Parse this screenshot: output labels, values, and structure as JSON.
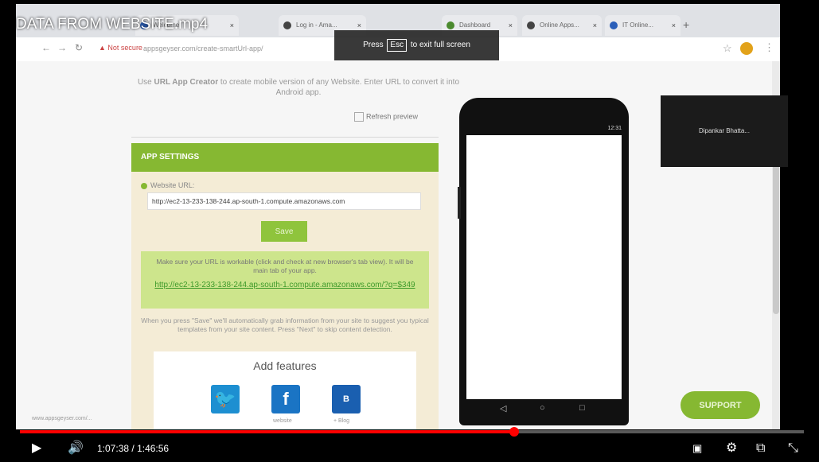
{
  "video": {
    "title": "DATA FROM WEBSITE.mp4",
    "fullscreen_hint_pre": "Press",
    "fullscreen_hint_key": "Esc",
    "fullscreen_hint_post": "to exit full screen",
    "viewer_name": "Dipankar Bhatta...",
    "current_time": "1:07:38",
    "time_separator": " / ",
    "duration": "1:46:56",
    "progress_fraction": 0.63
  },
  "browser": {
    "tabs": [
      {
        "label": "Welcome"
      },
      {
        "label": "Log in - Ama..."
      },
      {
        "label": "Dashboard"
      },
      {
        "label": "Online Apps..."
      },
      {
        "label": "IT Online..."
      }
    ],
    "new_tab": "+",
    "not_secure": "Not secure",
    "url": "appsgeyser.com/create-smartUrl-app/"
  },
  "page": {
    "intro_prefix": "Use",
    "intro_bold": "URL App Creator",
    "intro_rest": "to create mobile version of any Website. Enter URL to convert it into Android app.",
    "refresh_preview": "Refresh preview",
    "app_settings": "APP SETTINGS",
    "website_url_label": "Website URL:",
    "website_url_value": "http://ec2-13-233-138-244.ap-south-1.compute.amazonaws.com",
    "save_label": "Save",
    "note_text": "Make sure your URL is workable (click and check at new browser's tab view). It will be main tab of your app.",
    "note_link": "http://ec2-13-233-138-244.ap-south-1.compute.amazonaws.com/?q=$349",
    "after_save_text": "When you press \"Save\" we'll automatically grab information from your site to suggest you typical templates from your site content. Press \"Next\" to skip content detection.",
    "add_features": "Add features",
    "feature_captions": [
      "",
      "website",
      "+ Blog"
    ],
    "support": "SUPPORT",
    "footer_url": "www.appsgeyser.com/..."
  },
  "phone": {
    "status_text": "12:31"
  },
  "colors": {
    "accent_green": "#86b832",
    "progress_red": "#ff0000"
  }
}
